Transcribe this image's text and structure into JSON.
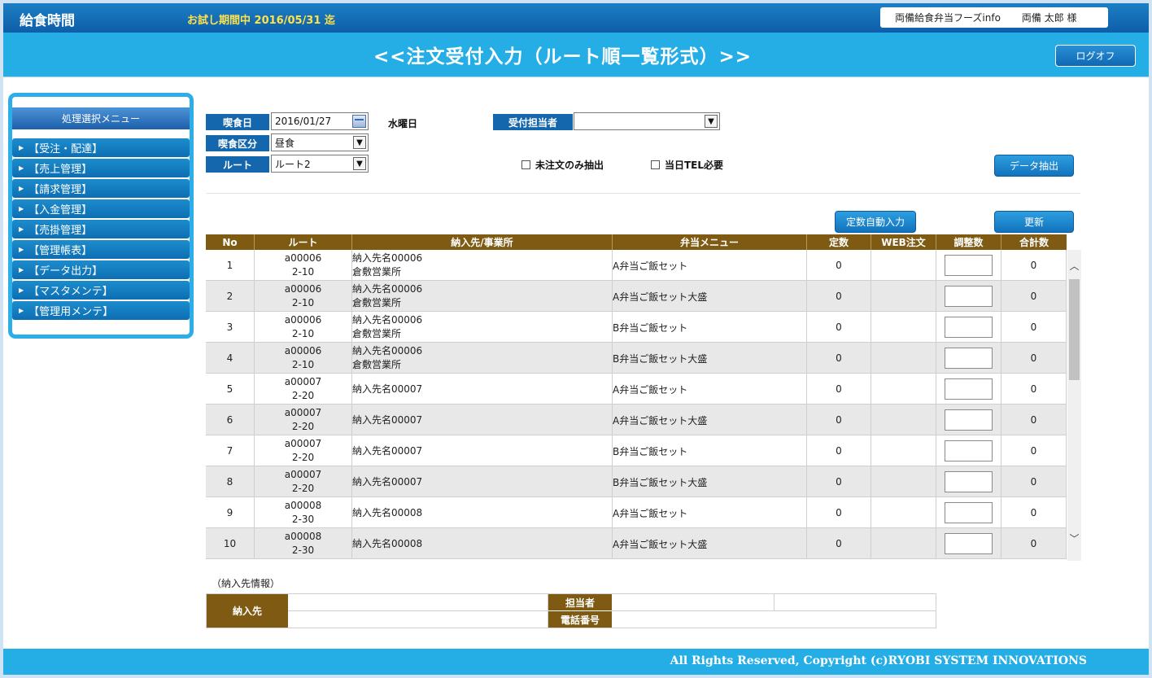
{
  "header": {
    "app_title": "給食時間",
    "trial_notice": "お試し期間中 2016/05/31 迄",
    "company": "両備給食弁当フーズinfo",
    "user": "両備 太郎 様",
    "page_title": "<<注文受付入力（ルート順一覧形式）>>",
    "logoff_label": "ログオフ"
  },
  "sidebar": {
    "title": "処理選択メニュー",
    "items": [
      {
        "label": "【受注・配達】"
      },
      {
        "label": "【売上管理】"
      },
      {
        "label": "【請求管理】"
      },
      {
        "label": "【入金管理】"
      },
      {
        "label": "【売掛管理】"
      },
      {
        "label": "【管理帳表】"
      },
      {
        "label": "【データ出力】"
      },
      {
        "label": "【マスタメンテ】"
      },
      {
        "label": "【管理用メンテ】"
      }
    ]
  },
  "filters": {
    "meal_date_label": "喫食日",
    "meal_date_value": "2016/01/27",
    "weekday": "水曜日",
    "meal_type_label": "喫食区分",
    "meal_type_value": "昼食",
    "route_label": "ルート",
    "route_value": "ルート2",
    "staff_label": "受付担当者",
    "staff_value": "",
    "unordered_only": "未注文のみ抽出",
    "tel_required": "当日TEL必要",
    "extract_button": "データ抽出",
    "auto_fill_button": "定数自動入力",
    "update_button": "更新"
  },
  "table": {
    "columns": [
      "No",
      "ルート",
      "納入先/事業所",
      "弁当メニュー",
      "定数",
      "WEB注文",
      "調整数",
      "合計数"
    ],
    "rows": [
      {
        "no": "1",
        "route1": "a00006",
        "route2": "2-10",
        "dest1": "納入先名00006",
        "dest2": "倉敷営業所",
        "menu": "A弁当ご飯セット",
        "fixed": "0",
        "web": "",
        "total": "0"
      },
      {
        "no": "2",
        "route1": "a00006",
        "route2": "2-10",
        "dest1": "納入先名00006",
        "dest2": "倉敷営業所",
        "menu": "A弁当ご飯セット大盛",
        "fixed": "0",
        "web": "",
        "total": "0"
      },
      {
        "no": "3",
        "route1": "a00006",
        "route2": "2-10",
        "dest1": "納入先名00006",
        "dest2": "倉敷営業所",
        "menu": "B弁当ご飯セット",
        "fixed": "0",
        "web": "",
        "total": "0"
      },
      {
        "no": "4",
        "route1": "a00006",
        "route2": "2-10",
        "dest1": "納入先名00006",
        "dest2": "倉敷営業所",
        "menu": "B弁当ご飯セット大盛",
        "fixed": "0",
        "web": "",
        "total": "0"
      },
      {
        "no": "5",
        "route1": "a00007",
        "route2": "2-20",
        "dest1": "納入先名00007",
        "dest2": "",
        "menu": "A弁当ご飯セット",
        "fixed": "0",
        "web": "",
        "total": "0"
      },
      {
        "no": "6",
        "route1": "a00007",
        "route2": "2-20",
        "dest1": "納入先名00007",
        "dest2": "",
        "menu": "A弁当ご飯セット大盛",
        "fixed": "0",
        "web": "",
        "total": "0"
      },
      {
        "no": "7",
        "route1": "a00007",
        "route2": "2-20",
        "dest1": "納入先名00007",
        "dest2": "",
        "menu": "B弁当ご飯セット",
        "fixed": "0",
        "web": "",
        "total": "0"
      },
      {
        "no": "8",
        "route1": "a00007",
        "route2": "2-20",
        "dest1": "納入先名00007",
        "dest2": "",
        "menu": "B弁当ご飯セット大盛",
        "fixed": "0",
        "web": "",
        "total": "0"
      },
      {
        "no": "9",
        "route1": "a00008",
        "route2": "2-30",
        "dest1": "納入先名00008",
        "dest2": "",
        "menu": "A弁当ご飯セット",
        "fixed": "0",
        "web": "",
        "total": "0"
      },
      {
        "no": "10",
        "route1": "a00008",
        "route2": "2-30",
        "dest1": "納入先名00008",
        "dest2": "",
        "menu": "A弁当ご飯セット大盛",
        "fixed": "0",
        "web": "",
        "total": "0"
      }
    ]
  },
  "delivery_info": {
    "caption": "（納入先情報）",
    "dest_label": "納入先",
    "staff_label": "担当者",
    "phone_label": "電話番号"
  },
  "footer": {
    "copyright": "All Rights Reserved, Copyright (c)RYOBI SYSTEM INNOVATIONS"
  }
}
